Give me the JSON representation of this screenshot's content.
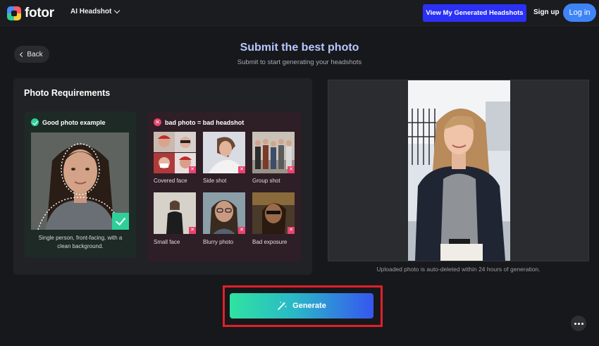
{
  "header": {
    "logo_text": "fotor",
    "product_label": "AI Headshot",
    "view_button": "View My Generated Headshots",
    "signup_label": "Sign up",
    "login_label": "Log in"
  },
  "page": {
    "back_label": "Back",
    "title": "Submit the best photo",
    "subtitle": "Submit to start generating your headshots"
  },
  "requirements": {
    "title": "Photo Requirements",
    "good": {
      "heading": "Good photo example",
      "caption_line1": "Single person, front-facing, with a",
      "caption_line2": "clean background."
    },
    "bad": {
      "heading": "bad photo = bad headshot",
      "examples": [
        {
          "label": "Covered face"
        },
        {
          "label": "Side shot"
        },
        {
          "label": "Group shot"
        },
        {
          "label": "Small face"
        },
        {
          "label": "Blurry photo"
        },
        {
          "label": "Bad exposure"
        }
      ]
    }
  },
  "upload": {
    "note": "Uploaded photo is auto-deleted within 24 hours of generation."
  },
  "generate_label": "Generate",
  "colors": {
    "accent_blue": "#2a31f4",
    "login_blue": "#3e84f7",
    "good_green": "#2fcf9a",
    "bad_red": "#e8436f",
    "highlight_red": "#e0202a"
  }
}
